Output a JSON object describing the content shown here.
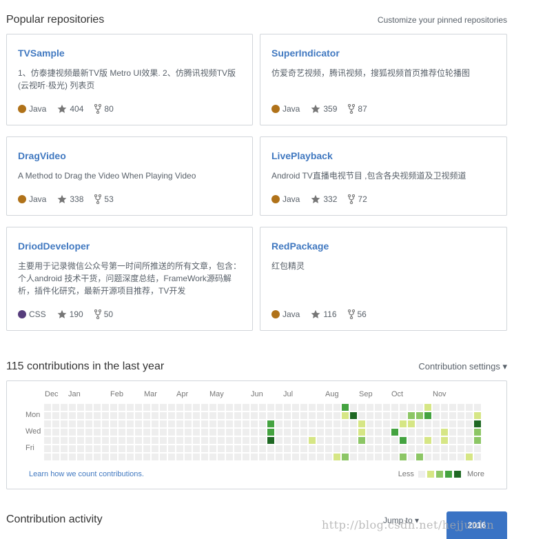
{
  "popular": {
    "title": "Popular repositories",
    "customize_link": "Customize your pinned repositories"
  },
  "repos": [
    {
      "name": "TVSample",
      "desc_lines": [
        "1、仿泰捷视频最新TV版 Metro UI效果. 2、仿腾讯视频TV版",
        "(云视听·极光) 列表页"
      ],
      "lang": "Java",
      "lang_color": "#b07219",
      "stars": "404",
      "forks": "80"
    },
    {
      "name": "SuperIndicator",
      "desc_lines": [
        "仿爱奇艺视频，腾讯视频，搜狐视频首页推荐位轮播图"
      ],
      "lang": "Java",
      "lang_color": "#b07219",
      "stars": "359",
      "forks": "87"
    },
    {
      "name": "DragVideo",
      "desc_lines": [
        "A Method to Drag the Video When Playing Video"
      ],
      "lang": "Java",
      "lang_color": "#b07219",
      "stars": "338",
      "forks": "53"
    },
    {
      "name": "LivePlayback",
      "desc_lines": [
        "Android TV直播电视节目 ,包含各央视频道及卫视频道"
      ],
      "lang": "Java",
      "lang_color": "#b07219",
      "stars": "332",
      "forks": "72"
    },
    {
      "name": "DriodDeveloper",
      "desc_lines": [
        "主要用于记录微信公众号第一时间所推送的所有文章，包含：",
        "个人android 技术干货，问题深度总结，FrameWork源码解",
        "析，插件化研究，最新开源项目推荐，TV开发"
      ],
      "lang": "CSS",
      "lang_color": "#563d7c",
      "stars": "190",
      "forks": "50"
    },
    {
      "name": "RedPackage",
      "desc_lines": [
        "红包精灵"
      ],
      "lang": "Java",
      "lang_color": "#b07219",
      "stars": "116",
      "forks": "56"
    }
  ],
  "contributions": {
    "title": "115 contributions in the last year",
    "settings_label": "Contribution settings ▾",
    "months": [
      "Dec",
      "Jan",
      "Feb",
      "Mar",
      "Apr",
      "May",
      "Jun",
      "Jul",
      "Aug",
      "Sep",
      "Oct",
      "Nov"
    ],
    "weekdays": [
      "Mon",
      "Wed",
      "Fri"
    ],
    "learn_link": "Learn how we count contributions.",
    "legend_less": "Less",
    "legend_more": "More",
    "colors": [
      "#eeeeee",
      "#d6e685",
      "#8cc665",
      "#44a340",
      "#1e6823"
    ],
    "grid": {
      "weeks": 56,
      "active": [
        [
          32,
          2,
          3
        ],
        [
          32,
          3,
          3
        ],
        [
          32,
          4,
          4
        ],
        [
          37,
          4,
          1
        ],
        [
          40,
          6,
          1
        ],
        [
          41,
          0,
          3
        ],
        [
          41,
          1,
          1
        ],
        [
          41,
          6,
          2
        ],
        [
          42,
          1,
          4
        ],
        [
          43,
          2,
          1
        ],
        [
          43,
          3,
          1
        ],
        [
          43,
          4,
          2
        ],
        [
          47,
          3,
          3
        ],
        [
          48,
          2,
          1
        ],
        [
          48,
          4,
          3
        ],
        [
          48,
          6,
          2
        ],
        [
          48,
          7,
          2
        ],
        [
          49,
          1,
          2
        ],
        [
          49,
          2,
          1
        ],
        [
          50,
          1,
          2
        ],
        [
          50,
          6,
          2
        ],
        [
          50,
          7,
          2
        ],
        [
          51,
          0,
          1
        ],
        [
          51,
          1,
          3
        ],
        [
          51,
          4,
          1
        ],
        [
          53,
          3,
          1
        ],
        [
          53,
          4,
          1
        ],
        [
          56,
          6,
          1
        ],
        [
          57,
          1,
          1
        ],
        [
          57,
          2,
          4
        ],
        [
          57,
          3,
          2
        ],
        [
          57,
          4,
          2
        ]
      ]
    }
  },
  "activity": {
    "title": "Contribution activity",
    "jump_label": "Jump to ▾",
    "year": "2016"
  },
  "watermark": "http://blog.csdn.net/hejjunlin"
}
